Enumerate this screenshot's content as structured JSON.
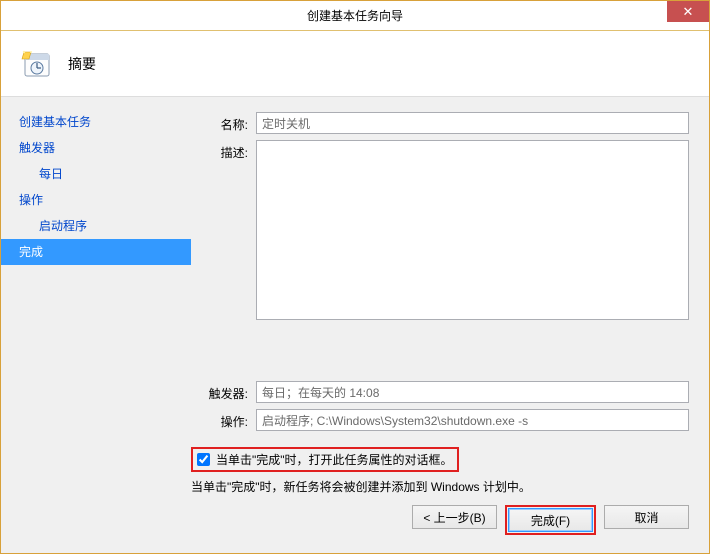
{
  "window": {
    "title": "创建基本任务向导"
  },
  "header": {
    "title": "摘要"
  },
  "sidebar": {
    "items": [
      {
        "label": "创建基本任务",
        "indent": false
      },
      {
        "label": "触发器",
        "indent": false
      },
      {
        "label": "每日",
        "indent": true
      },
      {
        "label": "操作",
        "indent": false
      },
      {
        "label": "启动程序",
        "indent": true
      },
      {
        "label": "完成",
        "indent": false,
        "selected": true
      }
    ]
  },
  "form": {
    "name_label": "名称:",
    "name_value": "定时关机",
    "desc_label": "描述:",
    "desc_value": "",
    "trigger_label": "触发器:",
    "trigger_value": "每日；在每天的 14:08",
    "action_label": "操作:",
    "action_value": "启动程序; C:\\Windows\\System32\\shutdown.exe -s"
  },
  "checkbox": {
    "label": "当单击\"完成\"时，打开此任务属性的对话框。",
    "checked": true
  },
  "info": "当单击\"完成\"时，新任务将会被创建并添加到 Windows 计划中。",
  "buttons": {
    "back": "< 上一步(B)",
    "finish": "完成(F)",
    "cancel": "取消"
  }
}
